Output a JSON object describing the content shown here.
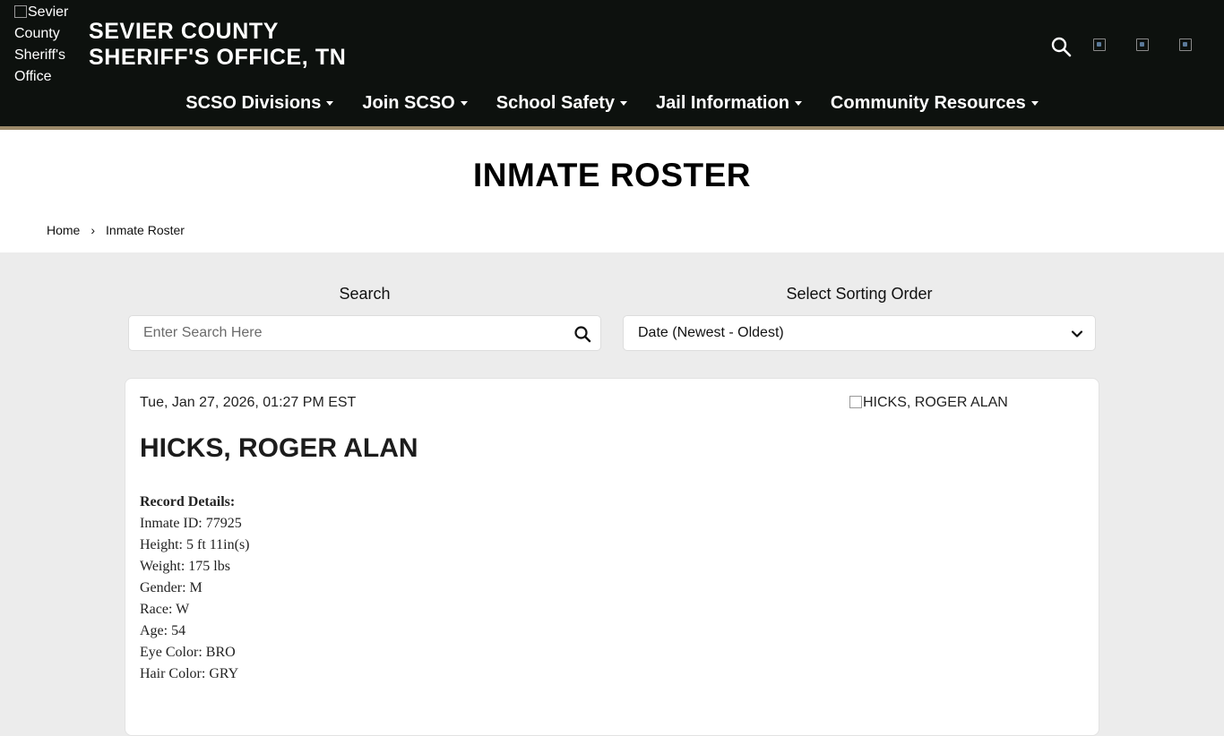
{
  "header": {
    "logo_alt": "Sevier County Sheriff's Office",
    "title_line1": "SEVIER COUNTY",
    "title_line2": "SHERIFF'S OFFICE, TN"
  },
  "nav": {
    "items": [
      {
        "label": "SCSO Divisions"
      },
      {
        "label": "Join SCSO"
      },
      {
        "label": "School Safety"
      },
      {
        "label": "Jail Information"
      },
      {
        "label": "Community Resources"
      }
    ]
  },
  "page": {
    "title": "INMATE ROSTER",
    "breadcrumb_home": "Home",
    "breadcrumb_sep": "›",
    "breadcrumb_current": "Inmate Roster"
  },
  "search": {
    "label": "Search",
    "placeholder": "Enter Search Here"
  },
  "sort": {
    "label": "Select Sorting Order",
    "selected": "Date (Newest - Oldest)"
  },
  "record": {
    "date": "Tue, Jan 27, 2026, 01:27 PM EST",
    "photo_alt": "HICKS, ROGER ALAN",
    "name": "HICKS, ROGER ALAN",
    "details_heading": "Record Details:",
    "details": [
      "Inmate ID: 77925",
      "Height: 5 ft 11in(s)",
      "Weight: 175 lbs",
      "Gender: M",
      "Race: W",
      "Age: 54",
      "Eye Color: BRO",
      "Hair Color: GRY"
    ]
  },
  "colors": {
    "header_bg": "#0d110e",
    "header_border": "#9c8a6a",
    "page_bg": "#ececec"
  },
  "icons": [
    "search-icon",
    "chevron-down-icon",
    "social-icon"
  ]
}
